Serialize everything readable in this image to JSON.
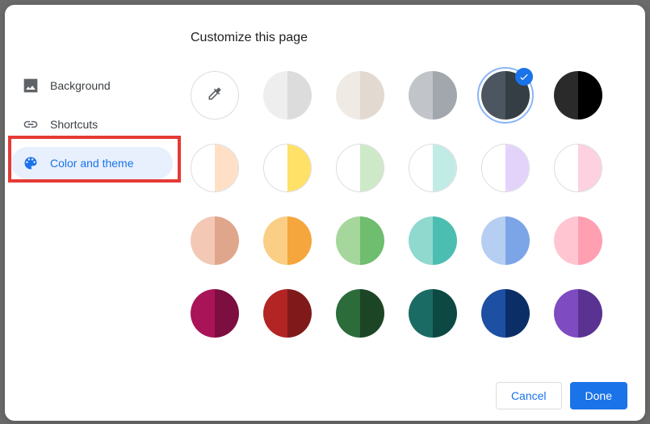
{
  "title": "Customize this page",
  "sidebar": {
    "items": [
      {
        "label": "Background"
      },
      {
        "label": "Shortcuts"
      },
      {
        "label": "Color and theme"
      }
    ],
    "activeIndex": 2
  },
  "swatches": {
    "row0": [
      {
        "left": "#ffffff",
        "right": "#f5f5f5",
        "picker": true
      },
      {
        "left": "#eeeeee",
        "right": "#dcdcdc"
      },
      {
        "left": "#efeae4",
        "right": "#e2d9d1"
      },
      {
        "left": "#c1c4c9",
        "right": "#a2a7ae"
      },
      {
        "left": "#4b5660",
        "right": "#353d45",
        "selected": true
      },
      {
        "left": "#2a2a2a",
        "right": "#000000"
      }
    ],
    "row1": [
      {
        "left": "#ffffff",
        "right": "#ffe0c7",
        "bordered": true
      },
      {
        "left": "#ffffff",
        "right": "#ffe168",
        "bordered": true
      },
      {
        "left": "#ffffff",
        "right": "#cde9c8",
        "bordered": true
      },
      {
        "left": "#ffffff",
        "right": "#c1ece6",
        "bordered": true
      },
      {
        "left": "#ffffff",
        "right": "#e3d3fb",
        "bordered": true
      },
      {
        "left": "#ffffff",
        "right": "#fdd1df",
        "bordered": true
      }
    ],
    "row2": [
      {
        "left": "#f3c8b5",
        "right": "#e0a68c"
      },
      {
        "left": "#fbce85",
        "right": "#f5a63c"
      },
      {
        "left": "#a5d69b",
        "right": "#6fbd6f"
      },
      {
        "left": "#8fd9cf",
        "right": "#4cbdb1"
      },
      {
        "left": "#b6cef2",
        "right": "#7ba5e6"
      },
      {
        "left": "#ffc6d1",
        "right": "#ff9fb2"
      }
    ],
    "row3": [
      {
        "left": "#a91458",
        "right": "#7c0f40"
      },
      {
        "left": "#b32424",
        "right": "#801a1a"
      },
      {
        "left": "#2c6b3a",
        "right": "#1c4526"
      },
      {
        "left": "#1a6b63",
        "right": "#0e4843"
      },
      {
        "left": "#1d4fa3",
        "right": "#0b2e66"
      },
      {
        "left": "#7e4bc0",
        "right": "#5a3291"
      }
    ]
  },
  "footer": {
    "cancel": "Cancel",
    "done": "Done"
  }
}
